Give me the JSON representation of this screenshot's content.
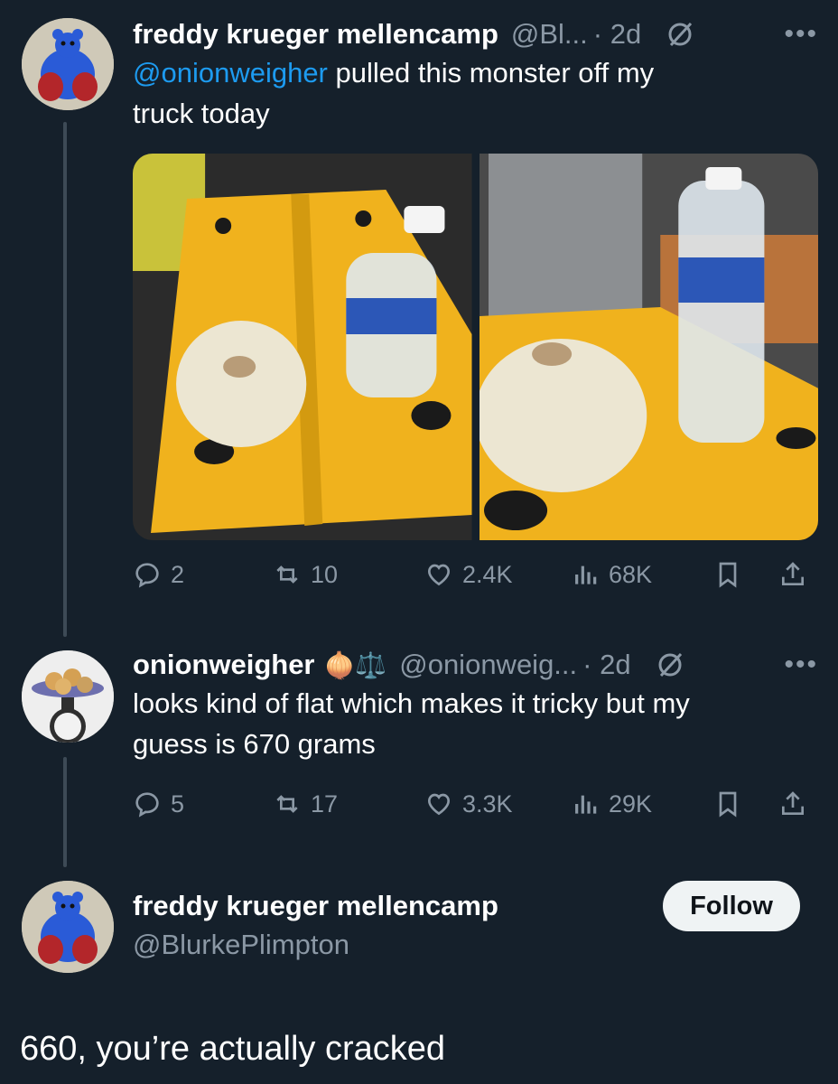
{
  "tweets": [
    {
      "name": "freddy krueger mellencamp",
      "handle": "@Bl...",
      "time": "· 2d",
      "mention": "@onionweigher",
      "text_line1": " pulled this monster off my",
      "text_line2": "truck today",
      "stats": {
        "replies": "2",
        "reposts": "10",
        "likes": "2.4K",
        "views": "68K"
      }
    },
    {
      "name": "onionweigher",
      "emoji": "🧅⚖️",
      "handle": "@onionweig...",
      "time": "· 2d",
      "text_line1": "looks kind of flat which makes it tricky but my",
      "text_line2": "guess is 670 grams",
      "stats": {
        "replies": "5",
        "reposts": "17",
        "likes": "3.3K",
        "views": "29K"
      }
    }
  ],
  "focused": {
    "name": "freddy krueger mellencamp",
    "handle": "@BlurkePlimpton",
    "follow_label": "Follow",
    "text": "660, you’re actually cracked"
  },
  "icons": {
    "reply": "reply-icon",
    "repost": "repost-icon",
    "like": "heart-icon",
    "views": "views-icon",
    "bookmark": "bookmark-icon",
    "share": "share-icon",
    "grok": "circle-slash-icon",
    "more": "more-icon"
  },
  "colors": {
    "background": "#15202b",
    "link": "#1d9bf0",
    "muted": "#8b98a5",
    "button_bg": "#eff3f4"
  }
}
